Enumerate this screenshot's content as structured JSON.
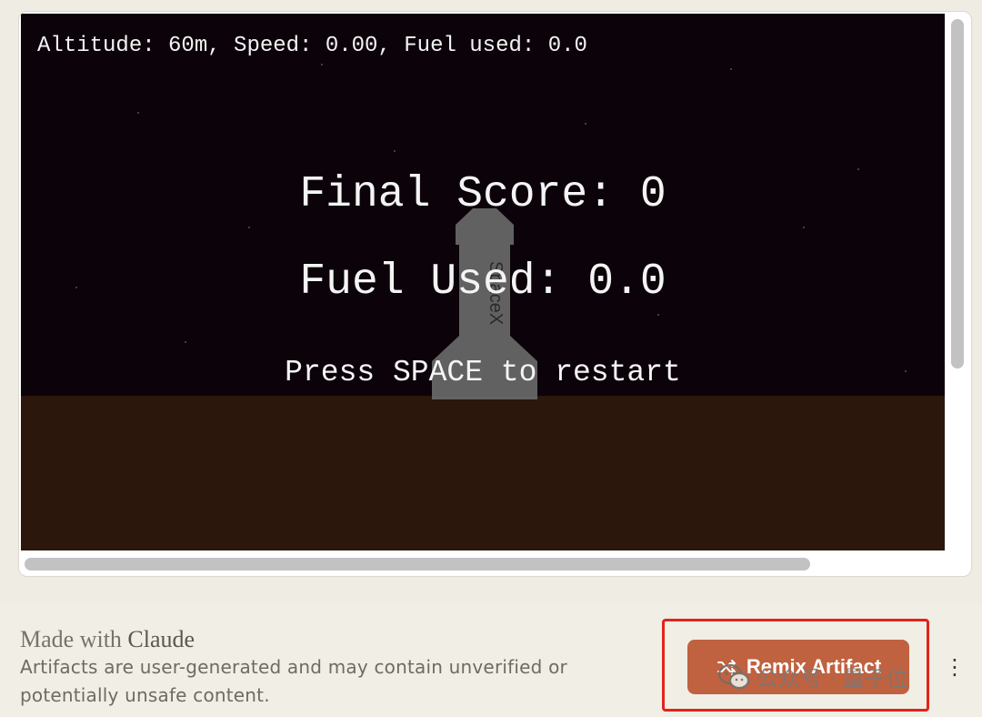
{
  "game": {
    "hud": "Altitude: 60m, Speed: 0.00, Fuel used: 0.0",
    "final_score": "Final Score: 0",
    "fuel_used": "Fuel Used: 0.0",
    "restart_prompt": "Press SPACE to restart",
    "rocket_label": "SpaceX",
    "colors": {
      "sky": "#0c020a",
      "ground": "#2b170b",
      "rocket": "#6c6c6c"
    }
  },
  "footer": {
    "made_with_prefix": "Made with ",
    "made_with_brand": "Claude",
    "disclaimer": "Artifacts are user-generated and may contain unverified or potentially unsafe content.",
    "remix_label": "Remix Artifact",
    "remix_icon": "shuffle-icon",
    "more_icon": "more-vertical-icon",
    "more_glyph": "⋮",
    "accent": "#c0623f",
    "highlight": "#e2231a"
  },
  "watermark": {
    "text": "公众号 · 量子位",
    "icon": "wechat-icon"
  }
}
